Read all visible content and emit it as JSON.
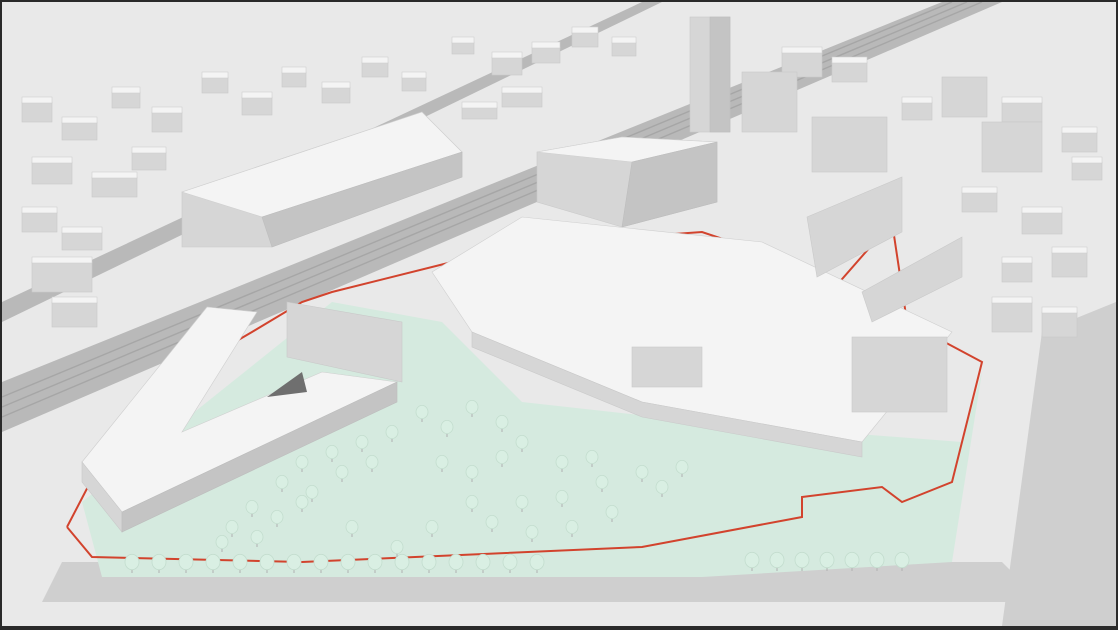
{
  "scene": {
    "kind": "urban-massing-render",
    "colors": {
      "background": "#e9e9e9",
      "block_top": "#f4f4f4",
      "block_side": "#d6d6d6",
      "block_shadow": "#c4c4c4",
      "rail": "#b9b9b9",
      "road": "#cfcfcf",
      "green": "#d5eadf",
      "tree": "#d9efe3",
      "boundary": "#d2432d",
      "frame": "#2a2a2a"
    }
  }
}
